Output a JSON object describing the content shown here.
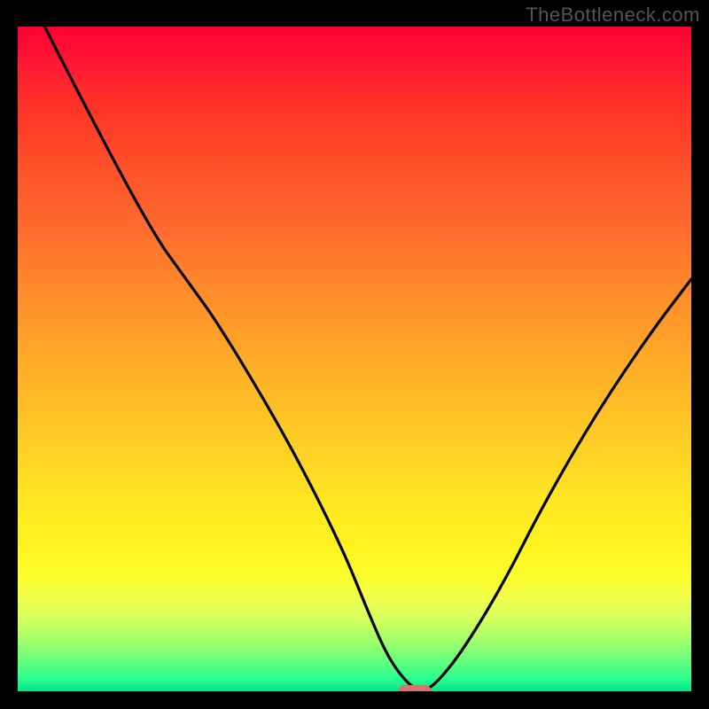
{
  "watermark": "TheBottleneck.com",
  "chart_data": {
    "type": "line",
    "title": "",
    "xlabel": "",
    "ylabel": "",
    "xlim": [
      0,
      100
    ],
    "ylim": [
      0,
      100
    ],
    "grid": false,
    "series": [
      {
        "name": "curve",
        "color": "#000000",
        "x": [
          4,
          10,
          20,
          25,
          30,
          40,
          48,
          52,
          55,
          58,
          60,
          62,
          66,
          72,
          78,
          86,
          94,
          100
        ],
        "y": [
          100,
          88,
          69,
          62,
          55,
          38,
          22,
          12,
          5,
          1,
          0,
          1,
          6,
          16,
          28,
          42,
          54,
          62
        ]
      }
    ],
    "optimum_marker": {
      "x": 59,
      "y": 0,
      "width": 5,
      "height": 2,
      "color": "#d9736b"
    },
    "background_gradient": {
      "top": "#ff0033",
      "mid": "#ffe822",
      "bottom": "#00e68c"
    }
  }
}
